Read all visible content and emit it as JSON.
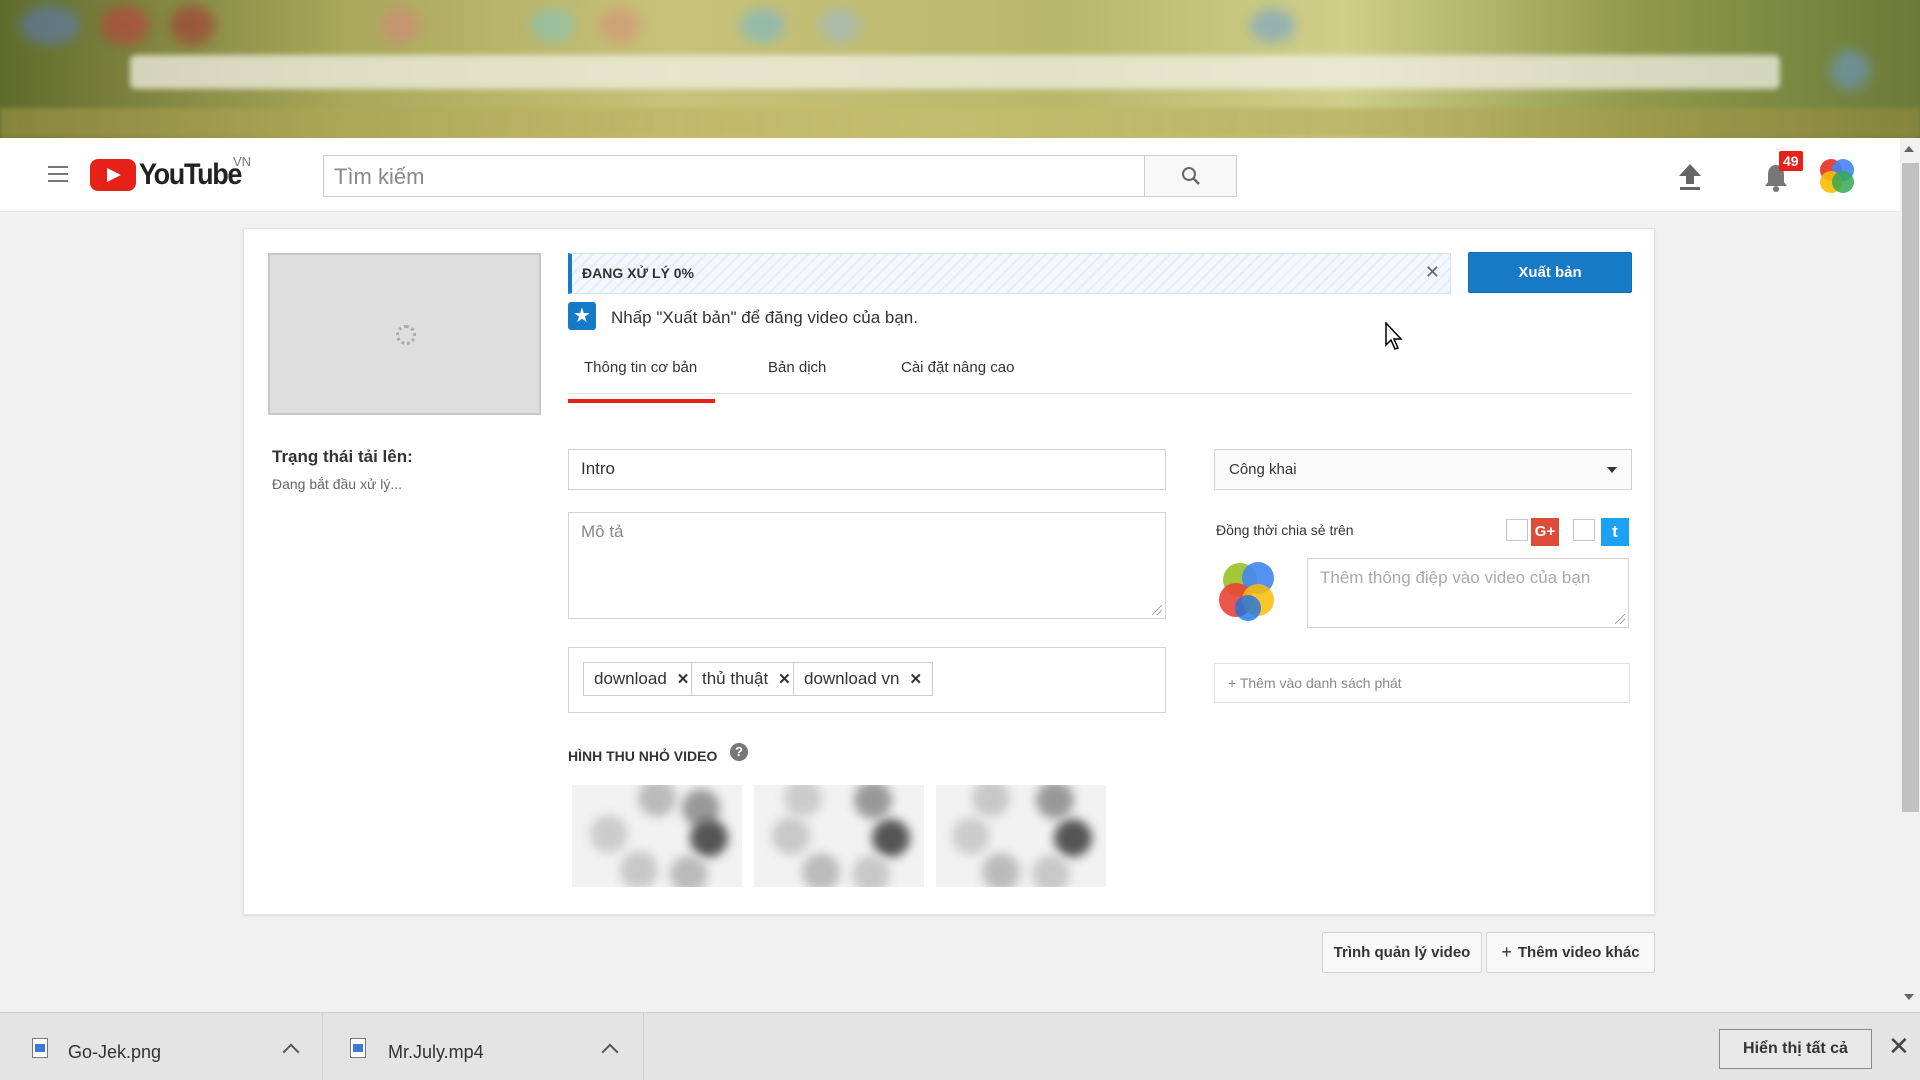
{
  "header": {
    "logo_text": "YouTube",
    "logo_country": "VN",
    "search_placeholder": "Tìm kiếm",
    "notification_count": "49"
  },
  "upload": {
    "status_label": "Trạng thái tải lên:",
    "status_value": "Đang bắt đầu xử lý...",
    "progress_text": "ĐANG XỬ LÝ 0%",
    "progress_percent": 0,
    "publish_label": "Xuất bản",
    "hint_text": "Nhấp \"Xuất bản\" để đăng video của bạn.",
    "tabs": [
      {
        "label": "Thông tin cơ bản",
        "active": true
      },
      {
        "label": "Bản dịch",
        "active": false
      },
      {
        "label": "Cài đặt nâng cao",
        "active": false
      }
    ],
    "title_value": "Intro",
    "description_placeholder": "Mô tả",
    "tags": [
      "download",
      "thủ thuật",
      "download vn"
    ],
    "thumbnails_label": "HÌNH THU NHỎ VIDEO",
    "help_glyph": "?",
    "privacy_value": "Công khai",
    "share_label": "Đồng thời chia sẻ trên",
    "gplus_glyph": "G+",
    "twitter_glyph": "t",
    "message_placeholder": "Thêm thông điệp vào video của bạn",
    "playlist_label": "+ Thêm vào danh sách phát"
  },
  "footer": {
    "video_manager": "Trình quản lý video",
    "add_more": "Thêm video khác"
  },
  "downloads": {
    "items": [
      {
        "name": "Go-Jek.png"
      },
      {
        "name": "Mr.July.mp4"
      }
    ],
    "show_all": "Hiển thị tất cả"
  },
  "colors": {
    "brand_red": "#e62117",
    "primary_blue": "#167ac6",
    "gplus_red": "#dd4b39",
    "twitter_blue": "#1da1f2"
  }
}
